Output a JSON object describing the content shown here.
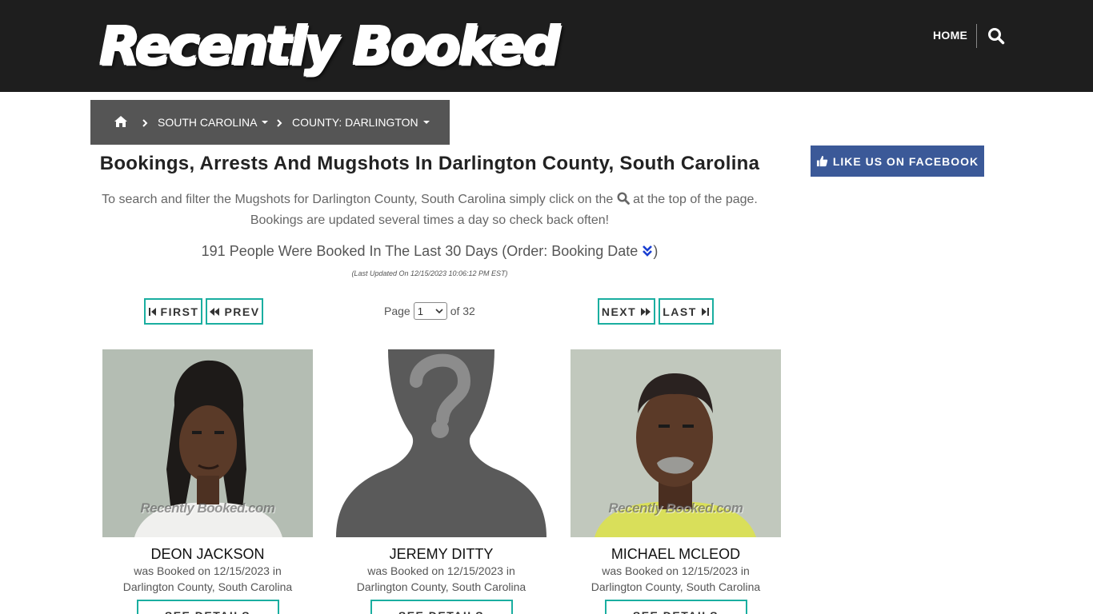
{
  "header": {
    "logo_text": "Recently Booked",
    "nav_home": "HOME",
    "search_icon": "search-icon"
  },
  "breadcrumb": {
    "home_icon": "home-icon",
    "items": [
      {
        "label": "SOUTH CAROLINA"
      },
      {
        "label": "COUNTY: DARLINGTON"
      }
    ]
  },
  "facebook": {
    "label": "LIKE US ON FACEBOOK",
    "icon": "thumbs-up-icon",
    "color": "#3b5998"
  },
  "main": {
    "title": "Bookings, Arrests And Mugshots In Darlington County, South Carolina",
    "intro_before": "To search and filter the Mugshots for Darlington County, South Carolina simply click on the",
    "intro_after": "at the top of the page. Bookings are updated several times a day so check back often!",
    "count_text": "191 People Were Booked In The Last 30 Days (Order: Booking Date",
    "count_close": ")",
    "updated": "(Last Updated On 12/15/2023 10:06:12 PM EST)"
  },
  "pagination": {
    "first": "FIRST",
    "prev": "PREV",
    "next": "NEXT",
    "last": "LAST",
    "page_label": "Page",
    "current_page": "1",
    "of_label": "of 32",
    "accent": "#1aaea0"
  },
  "cards": [
    {
      "name": "DEON JACKSON",
      "line1": "was Booked on 12/15/2023 in",
      "line2": "Darlington County, South Carolina",
      "watermark": "Recently Booked.com",
      "button": "SEE DETAILS"
    },
    {
      "name": "JEREMY DITTY",
      "line1": "was Booked on 12/15/2023 in",
      "line2": "Darlington County, South Carolina",
      "watermark": "",
      "button": "SEE DETAILS"
    },
    {
      "name": "MICHAEL MCLEOD",
      "line1": "was Booked on 12/15/2023 in",
      "line2": "Darlington County, South Carolina",
      "watermark": "Recently Booked.com",
      "button": "SEE DETAILS"
    }
  ]
}
